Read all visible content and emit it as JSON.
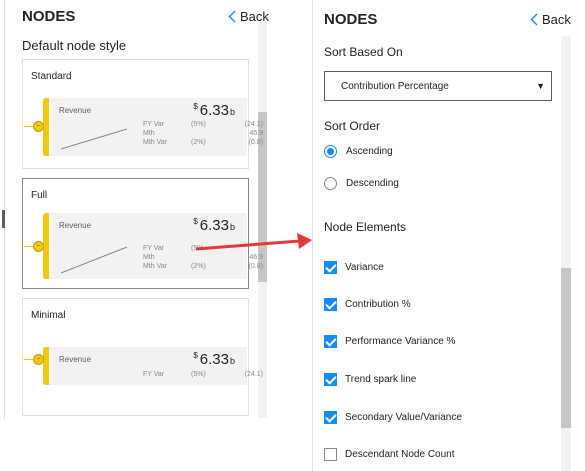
{
  "left_panel": {
    "title": "NODES",
    "back_label": "Back",
    "section_label": "Default node style",
    "cards": [
      {
        "title": "Standard",
        "node": {
          "name": "Revenue",
          "currency": "$",
          "value": "6.33",
          "suffix": "b",
          "metrics": [
            {
              "label": "FY Var",
              "pct": "(5%)",
              "val": "(24.1)"
            },
            {
              "label": "Mth",
              "pct": "",
              "val": "46.9"
            },
            {
              "label": "Mth Var",
              "pct": "(2%)",
              "val": "(0.8)"
            }
          ]
        }
      },
      {
        "title": "Full",
        "node": {
          "name": "Revenue",
          "currency": "$",
          "value": "6.33",
          "suffix": "b",
          "metrics": [
            {
              "label": "FY Var",
              "pct": "(5%",
              "val": ""
            },
            {
              "label": "Mth",
              "pct": "",
              "val": "46.9"
            },
            {
              "label": "Mth Var",
              "pct": "(2%)",
              "val": "(0.8)"
            }
          ]
        }
      },
      {
        "title": "Minimal",
        "node": {
          "name": "Revenue",
          "currency": "$",
          "value": "6.33",
          "suffix": "b",
          "metrics": [
            {
              "label": "FY Var",
              "pct": "(5%)",
              "val": "(24.1)"
            }
          ]
        }
      }
    ]
  },
  "right_panel": {
    "title": "NODES",
    "back_label": "Back",
    "sort_based_on": {
      "label": "Sort Based On",
      "selected": "Contribution Percentage"
    },
    "sort_order": {
      "label": "Sort Order",
      "options": [
        {
          "label": "Ascending",
          "checked": true
        },
        {
          "label": "Descending",
          "checked": false
        }
      ]
    },
    "node_elements": {
      "label": "Node Elements",
      "items": [
        {
          "label": "Variance",
          "checked": true
        },
        {
          "label": "Contribution %",
          "checked": true
        },
        {
          "label": "Performance Variance %",
          "checked": true
        },
        {
          "label": "Trend spark line",
          "checked": true
        },
        {
          "label": "Secondary Value/Variance",
          "checked": true
        },
        {
          "label": "Descendant Node Count",
          "checked": false
        }
      ]
    }
  },
  "colors": {
    "accent": "#118dff",
    "node_yellow": "#f2c811",
    "arrow_red": "#e03a3a"
  }
}
